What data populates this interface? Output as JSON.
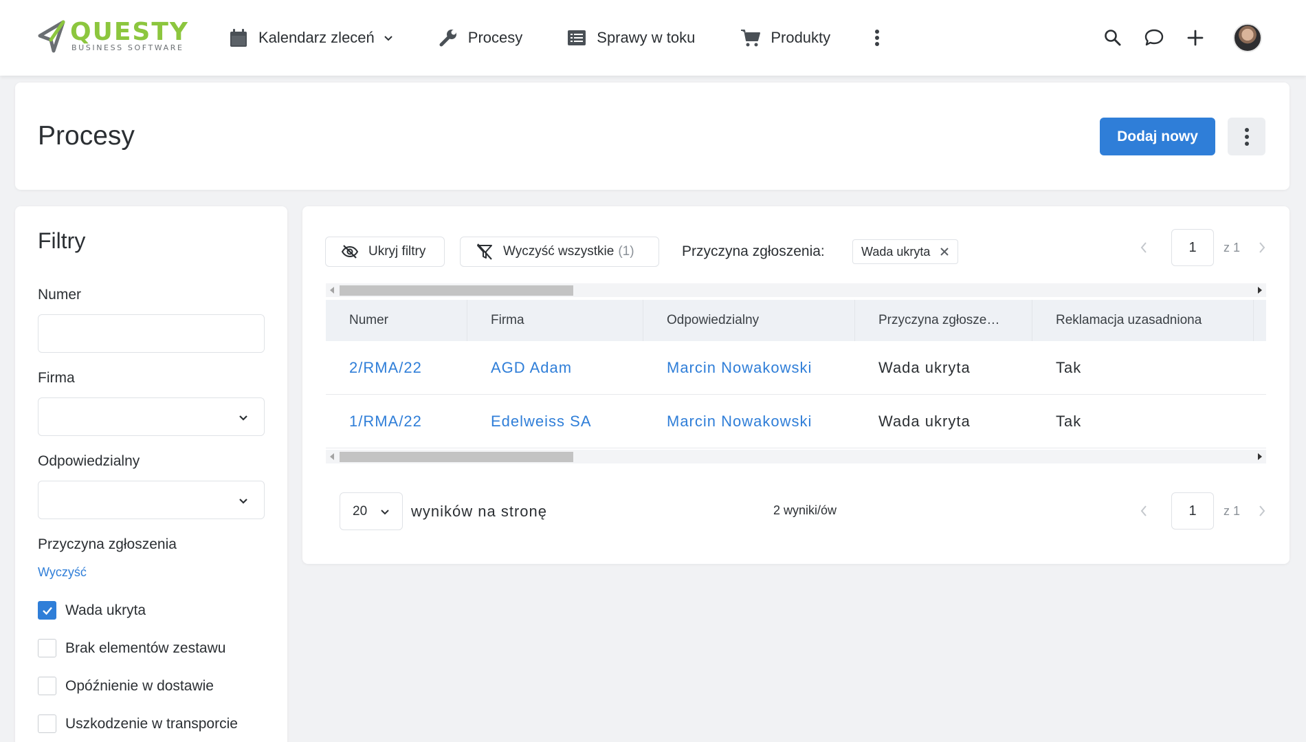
{
  "app": {
    "logo_word": "QUESTY",
    "logo_sub": "BUSINESS SOFTWARE",
    "brand_color": "#8cc63e",
    "accent_color": "#2f7ed8"
  },
  "nav": {
    "items": [
      {
        "label": "Kalendarz zleceń",
        "icon": "calendar-icon",
        "has_dropdown": true
      },
      {
        "label": "Procesy",
        "icon": "wrench-icon"
      },
      {
        "label": "Sprawy w toku",
        "icon": "list-icon"
      },
      {
        "label": "Produkty",
        "icon": "cart-icon"
      }
    ],
    "right_icons": [
      "search-icon",
      "chat-icon",
      "plus-icon",
      "avatar"
    ]
  },
  "header": {
    "title": "Procesy",
    "add_button": "Dodaj nowy"
  },
  "filters": {
    "title": "Filtry",
    "numer_label": "Numer",
    "numer_value": "",
    "firma_label": "Firma",
    "firma_value": "",
    "odpowiedzialny_label": "Odpowiedzialny",
    "odpowiedzialny_value": "",
    "przyczyna_label": "Przyczyna zgłoszenia",
    "clear_link": "Wyczyść",
    "options": [
      {
        "label": "Wada ukryta",
        "checked": true
      },
      {
        "label": "Brak elementów zestawu",
        "checked": false
      },
      {
        "label": "Opóźnienie w dostawie",
        "checked": false
      },
      {
        "label": "Uszkodzenie w transporcie",
        "checked": false
      }
    ]
  },
  "toolbar": {
    "hide_filters": "Ukryj filtry",
    "clear_all": "Wyczyść wszystkie",
    "clear_all_count": "(1)",
    "active_filter_label": "Przyczyna zgłoszenia:",
    "active_filter_chip": "Wada ukryta"
  },
  "pagination": {
    "page": "1",
    "of": "z 1"
  },
  "table": {
    "columns": [
      "Numer",
      "Firma",
      "Odpowiedzialny",
      "Przyczyna zgłosze…",
      "Reklamacja uzasadniona"
    ],
    "rows": [
      [
        "2/RMA/22",
        "AGD Adam",
        "Marcin Nowakowski",
        "Wada ukryta",
        "Tak"
      ],
      [
        "1/RMA/22",
        "Edelweiss SA",
        "Marcin Nowakowski",
        "Wada ukryta",
        "Tak"
      ]
    ]
  },
  "footer": {
    "per_page": "20",
    "per_page_label": "wyników na stronę",
    "results": "2 wyniki/ów"
  }
}
